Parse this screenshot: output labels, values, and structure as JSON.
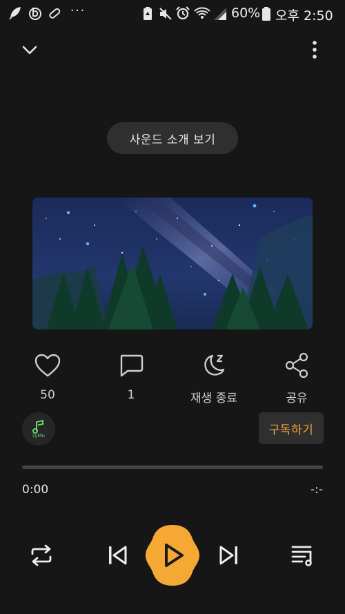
{
  "status_bar": {
    "battery_percent": "60%",
    "time": "오후 2:50",
    "overflow_dots": "···"
  },
  "header": {
    "collapse_icon": "chevron-down-icon",
    "menu_icon": "more-vertical-icon"
  },
  "sound_intro_button": "사운드 소개 보기",
  "actions": {
    "like_count": "50",
    "comment_count": "1",
    "sleep_timer_label": "재생 종료",
    "share_label": "공유"
  },
  "channel": {
    "avatar_text": "LyMu"
  },
  "subscribe_button": "구독하기",
  "player": {
    "progress": 0,
    "current_time": "0:00",
    "total_time": "-:-"
  },
  "colors": {
    "background": "#161616",
    "accent": "#f5a833",
    "button_bg": "#2f2f2f"
  }
}
